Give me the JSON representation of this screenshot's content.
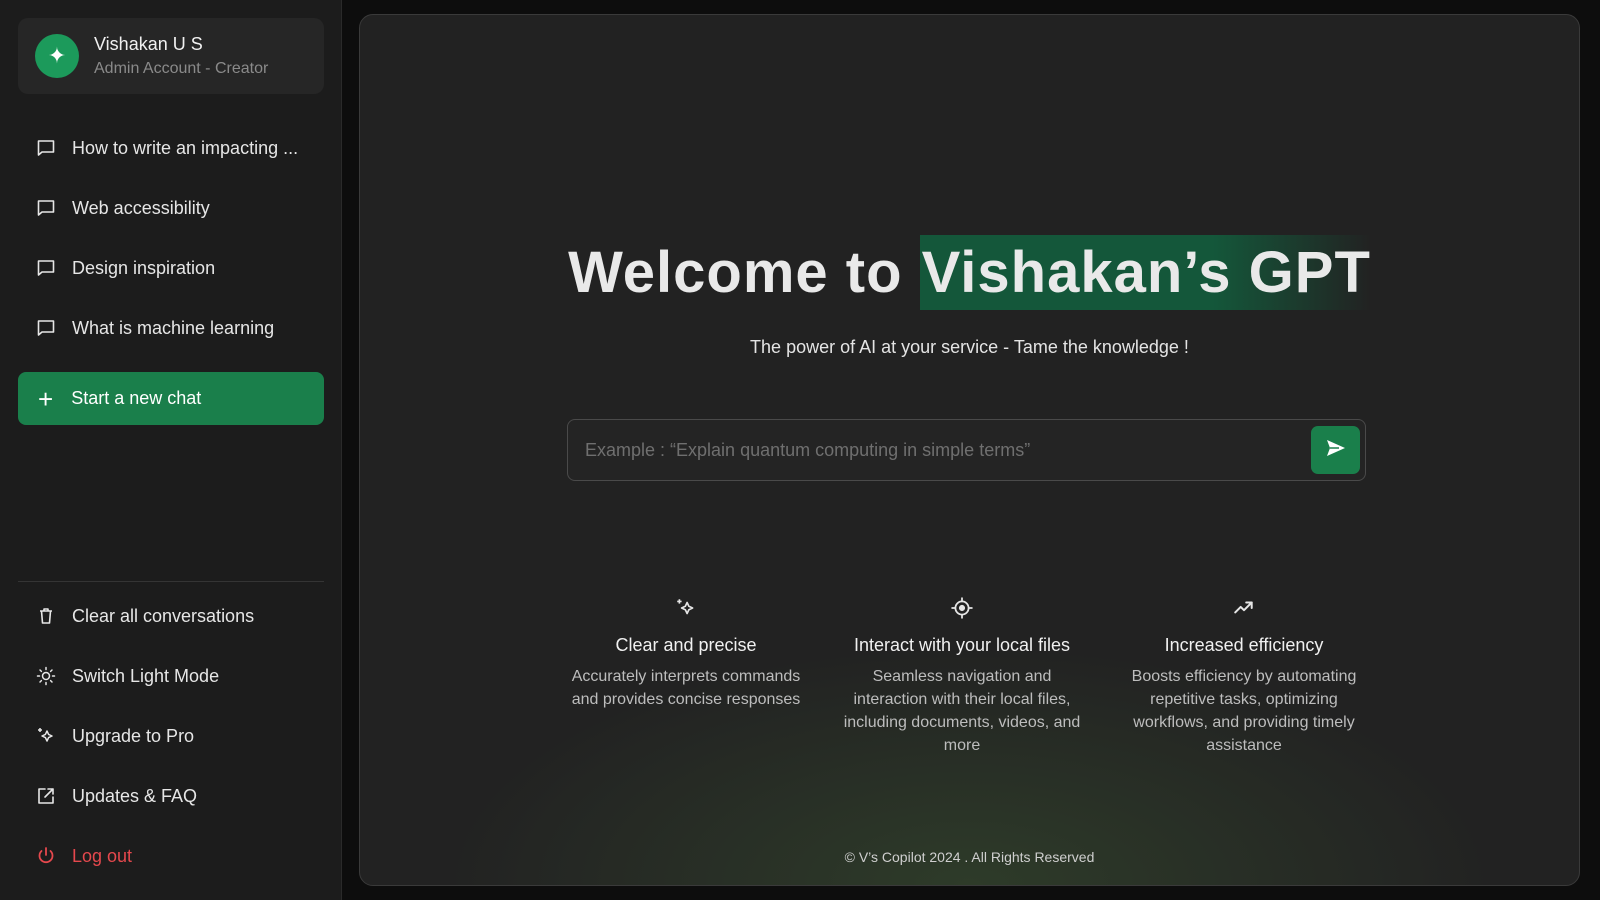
{
  "profile": {
    "name": "Vishakan U S",
    "role": "Admin Account - Creator",
    "avatar_icon": "sparkle-icon"
  },
  "history": [
    {
      "label": "How to write an impacting ...",
      "icon": "chat-bubble-icon"
    },
    {
      "label": "Web accessibility",
      "icon": "chat-bubble-icon"
    },
    {
      "label": "Design inspiration",
      "icon": "chat-bubble-icon"
    },
    {
      "label": "What is machine learning",
      "icon": "chat-bubble-icon"
    }
  ],
  "new_chat": {
    "label": "Start a new chat",
    "icon": "plus-icon"
  },
  "bottom_menu": [
    {
      "label": "Clear all conversations",
      "icon": "trash-icon"
    },
    {
      "label": "Switch Light Mode",
      "icon": "sun-icon"
    },
    {
      "label": "Upgrade to Pro",
      "icon": "sparkle-icon"
    },
    {
      "label": "Updates & FAQ",
      "icon": "external-link-icon"
    },
    {
      "label": "Log out",
      "icon": "power-icon"
    }
  ],
  "hero": {
    "title_prefix": "Welcome to ",
    "title_highlight": "Vishakan’s GPT",
    "subtitle": "The power of AI at your service - Tame the knowledge !"
  },
  "prompt": {
    "placeholder": "Example : “Explain quantum computing in simple terms”",
    "value": "",
    "send_icon": "send-icon"
  },
  "features": [
    {
      "title": "Clear and precise",
      "desc": "Accurately interprets commands and provides concise responses",
      "icon": "sparkle-icon"
    },
    {
      "title": "Interact with your local files",
      "desc": "Seamless navigation and interaction with their local files, including documents, videos, and more",
      "icon": "target-icon"
    },
    {
      "title": "Increased efficiency",
      "desc": "Boosts efficiency by automating repetitive tasks, optimizing workflows, and providing timely assistance",
      "icon": "trend-up-icon"
    }
  ],
  "footer": "© V’s Copilot 2024 . All Rights Reserved",
  "colors": {
    "accent": "#1a7f4b",
    "highlight": "#14573a",
    "danger": "#e5484d",
    "sidebar_bg": "#1c1c1c",
    "panel_bg": "#222222"
  }
}
